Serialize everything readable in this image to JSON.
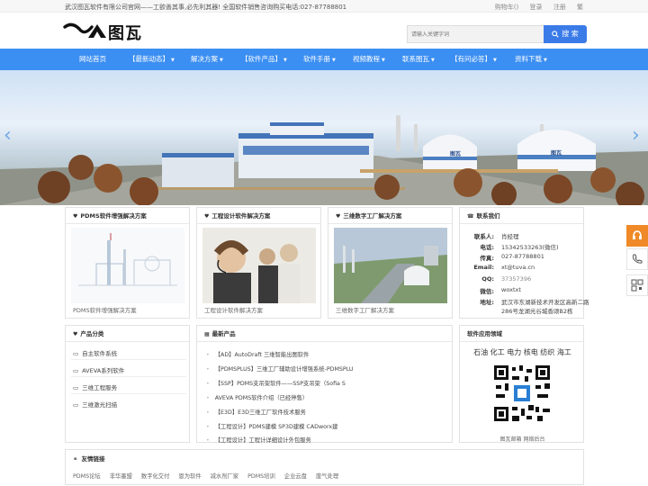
{
  "topbar": {
    "notice": "武汉图瓦软件有限公司官网——工欲善其事,必先利其器! 全国软件销售咨询购买电话:027-87788801",
    "links": [
      "购物车()",
      "登录",
      "注册",
      "繁"
    ]
  },
  "header": {
    "logo_text": "图瓦",
    "search_placeholder": "请输入关键字词",
    "search_button": "搜 索"
  },
  "nav": {
    "items": [
      {
        "label": "网站首页",
        "caret": false
      },
      {
        "label": "【最新动态】",
        "caret": true
      },
      {
        "label": "解决方案",
        "caret": true
      },
      {
        "label": "【软件产品】",
        "caret": true
      },
      {
        "label": "软件手册",
        "caret": true
      },
      {
        "label": "视频教程",
        "caret": true
      },
      {
        "label": "联系图瓦",
        "caret": true
      },
      {
        "label": "【有问必答】",
        "caret": true
      },
      {
        "label": "资料下载",
        "caret": true
      }
    ]
  },
  "banner": {
    "sign_text": "图瓦",
    "prev": "‹",
    "next": "›"
  },
  "solutions": [
    {
      "title": "PDMS软件增强解决方案",
      "caption": "PDMS软件增强解决方案"
    },
    {
      "title": "工程设计软件解决方案",
      "caption": "工程设计软件解决方案"
    },
    {
      "title": "三维数字工厂解决方案",
      "caption": "三维数字工厂解决方案"
    }
  ],
  "contact": {
    "title": "联系我们",
    "rows": [
      {
        "k": "联系人:",
        "v": "肖经理"
      },
      {
        "k": "电话:",
        "v": "15342533263(微信)"
      },
      {
        "k": "传真:",
        "v": "027-87788801"
      },
      {
        "k": "Email:",
        "v": "xt@tuva.cn"
      },
      {
        "k": "QQ:",
        "v": "37357396"
      },
      {
        "k": "微信:",
        "v": "woxtxt"
      },
      {
        "k": "地址:",
        "v": "武汉市东湖新技术开发区高新二路"
      },
      {
        "k": "",
        "v": "286号龙湖光谷城香颂B2栋"
      }
    ]
  },
  "categories": {
    "title": "产品分类",
    "items": [
      "自主软件系统",
      "AVEVA系列软件",
      "三维工程服务",
      "三维激光扫描"
    ]
  },
  "news": {
    "title": "最新产品",
    "items": [
      "【AD】AutoDraft 三维智能出图软件",
      "【PDMSPLUS】三维工厂辅助设计增强系统-PDMSPLU",
      "【SSP】PDMS支吊架软件——SSP支吊架（Sofia S",
      "AVEVA PDMS软件介绍（已经停售）",
      "【E3D】E3D三维工厂软件技术服务",
      "【工程设计】PDMS建模 SP3D建模 CADworx建",
      "【工程设计】工程计详细设计外包服务"
    ]
  },
  "fields": {
    "title": "软件应用领域",
    "text": "石油 化工 电力 核电 纺织 海工",
    "qr_caption": "图瓦邮箱 网络后台"
  },
  "friends": {
    "title": "友情链接",
    "links": [
      "PDMS论坛",
      "非华墨盟",
      "数字化交付",
      "恩为软件",
      "减水剂厂家",
      "PDMS培训",
      "企业云盘",
      "废气处理"
    ]
  },
  "colors": {
    "nav_blue": "#3c8ff2",
    "search_blue": "#3b7be8",
    "side_orange": "#f08a28"
  }
}
